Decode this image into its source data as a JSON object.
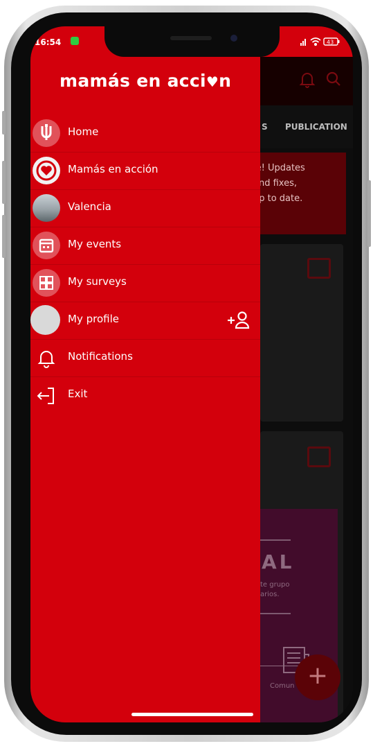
{
  "status": {
    "time": "16:54",
    "battery": "43"
  },
  "drawer": {
    "logo": "mamás en acci",
    "logo_heart": "♥",
    "logo_end": "n",
    "items": [
      {
        "label": "Home",
        "icon": "home-icon"
      },
      {
        "label": "Mamás en acción",
        "icon": "mamas-en-accion-logo-icon"
      },
      {
        "label": "Valencia",
        "icon": "valencia-photo-icon"
      },
      {
        "label": "My events",
        "icon": "calendar-icon"
      },
      {
        "label": "My surveys",
        "icon": "surveys-icon"
      },
      {
        "label": "My profile",
        "icon": "avatar-icon",
        "action_icon": "add-user-icon",
        "action_label": "+"
      },
      {
        "label": "Notifications",
        "icon": "bell-icon"
      },
      {
        "label": "Exit",
        "icon": "exit-icon"
      }
    ]
  },
  "background": {
    "tab_partial": "S",
    "tab_publications": "PUBLICATION",
    "alert_lines": [
      "le! Updates",
      "and fixes,",
      "up to date."
    ],
    "purple_title": "AL",
    "purple_sub_1": "te grupo",
    "purple_sub_2": "arios.",
    "purple_caption": "Comun",
    "fab_label": "+"
  },
  "colors": {
    "brand_red": "#d3000c",
    "dim_overlay": "#0d0d0d"
  }
}
